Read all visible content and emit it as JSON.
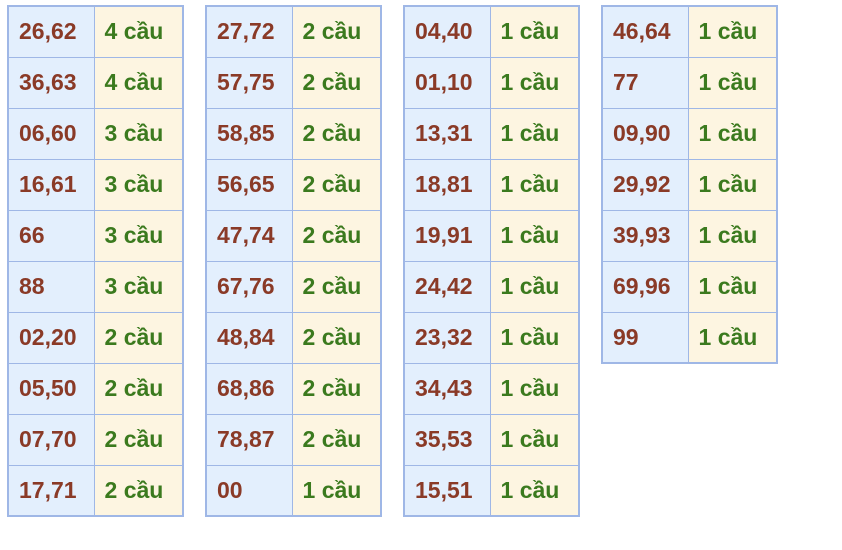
{
  "colors": {
    "number_text": "#8a3a27",
    "count_text": "#3b7a1e",
    "number_bg": "#e3effd",
    "count_bg": "#fdf5e1",
    "border": "#9fb7e6"
  },
  "columns": [
    [
      {
        "pair": "26,62",
        "count": "4 cầu"
      },
      {
        "pair": "36,63",
        "count": "4 cầu"
      },
      {
        "pair": "06,60",
        "count": "3 cầu"
      },
      {
        "pair": "16,61",
        "count": "3 cầu"
      },
      {
        "pair": "66",
        "count": "3 cầu"
      },
      {
        "pair": "88",
        "count": "3 cầu"
      },
      {
        "pair": "02,20",
        "count": "2 cầu"
      },
      {
        "pair": "05,50",
        "count": "2 cầu"
      },
      {
        "pair": "07,70",
        "count": "2 cầu"
      },
      {
        "pair": "17,71",
        "count": "2 cầu"
      }
    ],
    [
      {
        "pair": "27,72",
        "count": "2 cầu"
      },
      {
        "pair": "57,75",
        "count": "2 cầu"
      },
      {
        "pair": "58,85",
        "count": "2 cầu"
      },
      {
        "pair": "56,65",
        "count": "2 cầu"
      },
      {
        "pair": "47,74",
        "count": "2 cầu"
      },
      {
        "pair": "67,76",
        "count": "2 cầu"
      },
      {
        "pair": "48,84",
        "count": "2 cầu"
      },
      {
        "pair": "68,86",
        "count": "2 cầu"
      },
      {
        "pair": "78,87",
        "count": "2 cầu"
      },
      {
        "pair": "00",
        "count": "1 cầu"
      }
    ],
    [
      {
        "pair": "04,40",
        "count": "1 cầu"
      },
      {
        "pair": "01,10",
        "count": "1 cầu"
      },
      {
        "pair": "13,31",
        "count": "1 cầu"
      },
      {
        "pair": "18,81",
        "count": "1 cầu"
      },
      {
        "pair": "19,91",
        "count": "1 cầu"
      },
      {
        "pair": "24,42",
        "count": "1 cầu"
      },
      {
        "pair": "23,32",
        "count": "1 cầu"
      },
      {
        "pair": "34,43",
        "count": "1 cầu"
      },
      {
        "pair": "35,53",
        "count": "1 cầu"
      },
      {
        "pair": "15,51",
        "count": "1 cầu"
      }
    ],
    [
      {
        "pair": "46,64",
        "count": "1 cầu"
      },
      {
        "pair": "77",
        "count": "1 cầu"
      },
      {
        "pair": "09,90",
        "count": "1 cầu"
      },
      {
        "pair": "29,92",
        "count": "1 cầu"
      },
      {
        "pair": "39,93",
        "count": "1 cầu"
      },
      {
        "pair": "69,96",
        "count": "1 cầu"
      },
      {
        "pair": "99",
        "count": "1 cầu"
      }
    ]
  ]
}
